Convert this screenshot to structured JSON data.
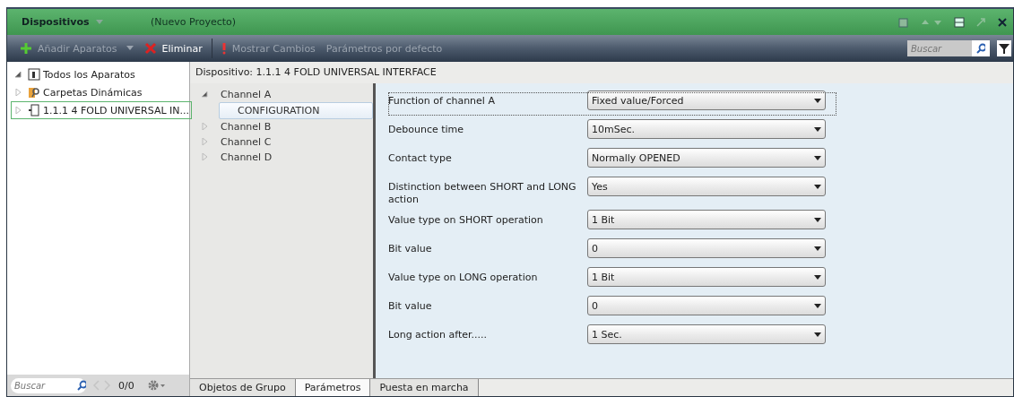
{
  "title_bar": {
    "panel_title": "Dispositivos",
    "project": "(Nuevo Proyecto)"
  },
  "toolbar": {
    "buttons": [
      {
        "label": "Añadir Aparatos",
        "kind": "add",
        "disabled": true
      },
      {
        "label": "Eliminar",
        "kind": "delete",
        "disabled": false
      },
      {
        "label": "Mostrar Cambios",
        "kind": "changes",
        "disabled": true
      },
      {
        "label": "Parámetros por defecto",
        "kind": "defaults",
        "disabled": true
      }
    ],
    "search": {
      "placeholder": "Buscar"
    }
  },
  "device_tree": [
    {
      "label": "Todos los Aparatos",
      "kind": "all",
      "expanded": true,
      "selected": false,
      "children": [
        {
          "label": "Carpetas Dinámicas",
          "kind": "folder",
          "expanded": false,
          "selected": false
        },
        {
          "label": "1.1.1  4 FOLD UNIVERSAL IN...",
          "kind": "device",
          "expanded": false,
          "selected": true
        }
      ]
    }
  ],
  "left_footer": {
    "search": {
      "placeholder": "Buscar"
    },
    "counter": "0/0"
  },
  "device_header": "Dispositivo: 1.1.1  4 FOLD UNIVERSAL INTERFACE",
  "channels": [
    {
      "label": "Channel A",
      "expanded": true,
      "selected": false,
      "children": [
        {
          "label": "CONFIGURATION",
          "selected": true
        }
      ]
    },
    {
      "label": "Channel B",
      "expanded": false,
      "selected": false
    },
    {
      "label": "Channel C",
      "expanded": false,
      "selected": false
    },
    {
      "label": "Channel D",
      "expanded": false,
      "selected": false
    }
  ],
  "parameters": [
    {
      "label": "Function of channel A",
      "value": "Fixed value/Forced",
      "focused": true
    },
    {
      "label": "Debounce time",
      "value": "10mSec.",
      "focused": false
    },
    {
      "label": "Contact type",
      "value": "Normally OPENED",
      "focused": false
    },
    {
      "label": "Distinction between SHORT and LONG action",
      "value": "Yes",
      "focused": false
    },
    {
      "label": "Value type on SHORT operation",
      "value": "1 Bit",
      "focused": false
    },
    {
      "label": "Bit value",
      "value": "0",
      "focused": false
    },
    {
      "label": "Value type on LONG operation",
      "value": "1 Bit",
      "focused": false
    },
    {
      "label": "Bit value",
      "value": "0",
      "focused": false
    },
    {
      "label": "Long action after.....",
      "value": "1 Sec.",
      "focused": false
    }
  ],
  "bottom_tabs": [
    {
      "label": "Objetos de Grupo",
      "selected": false
    },
    {
      "label": "Parámetros",
      "selected": true
    },
    {
      "label": "Puesta en marcha",
      "selected": false
    }
  ]
}
